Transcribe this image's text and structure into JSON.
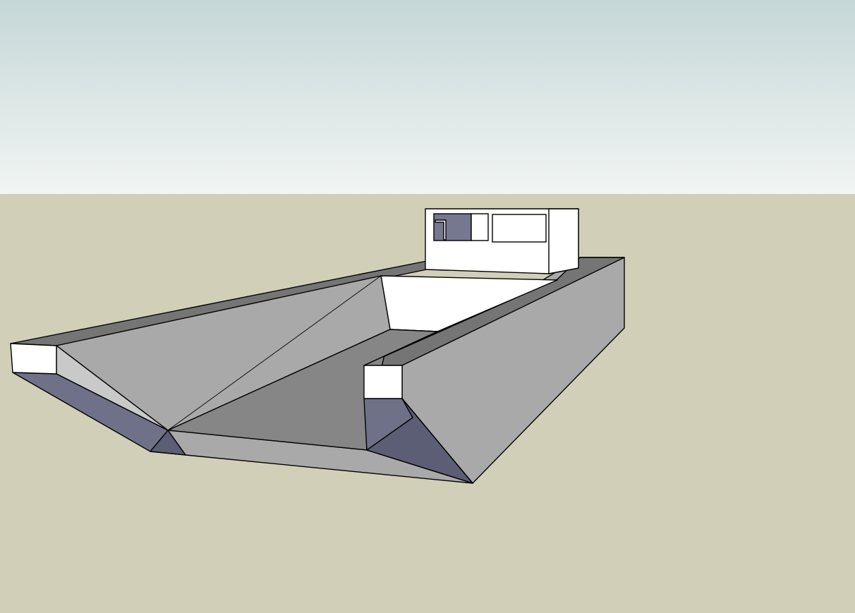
{
  "colors": {
    "sky_top": "#c5d7d7",
    "sky_bottom": "#f1f5f3",
    "ground": "#d1cfb8",
    "face_white": "#ffffff",
    "face_light_gray": "#a9a9a9",
    "face_mid_gray": "#868686",
    "face_dark_gray": "#757575",
    "face_inner_light": "#c9c9c9",
    "face_back_blue": "#6f7189",
    "face_back_blue_dark": "#5b5e74",
    "window_glass": "#767791",
    "edge": "#000000"
  },
  "scene": {
    "model": "boat-hull-with-cabin",
    "background": "sky-gradient-and-ground-plane"
  }
}
